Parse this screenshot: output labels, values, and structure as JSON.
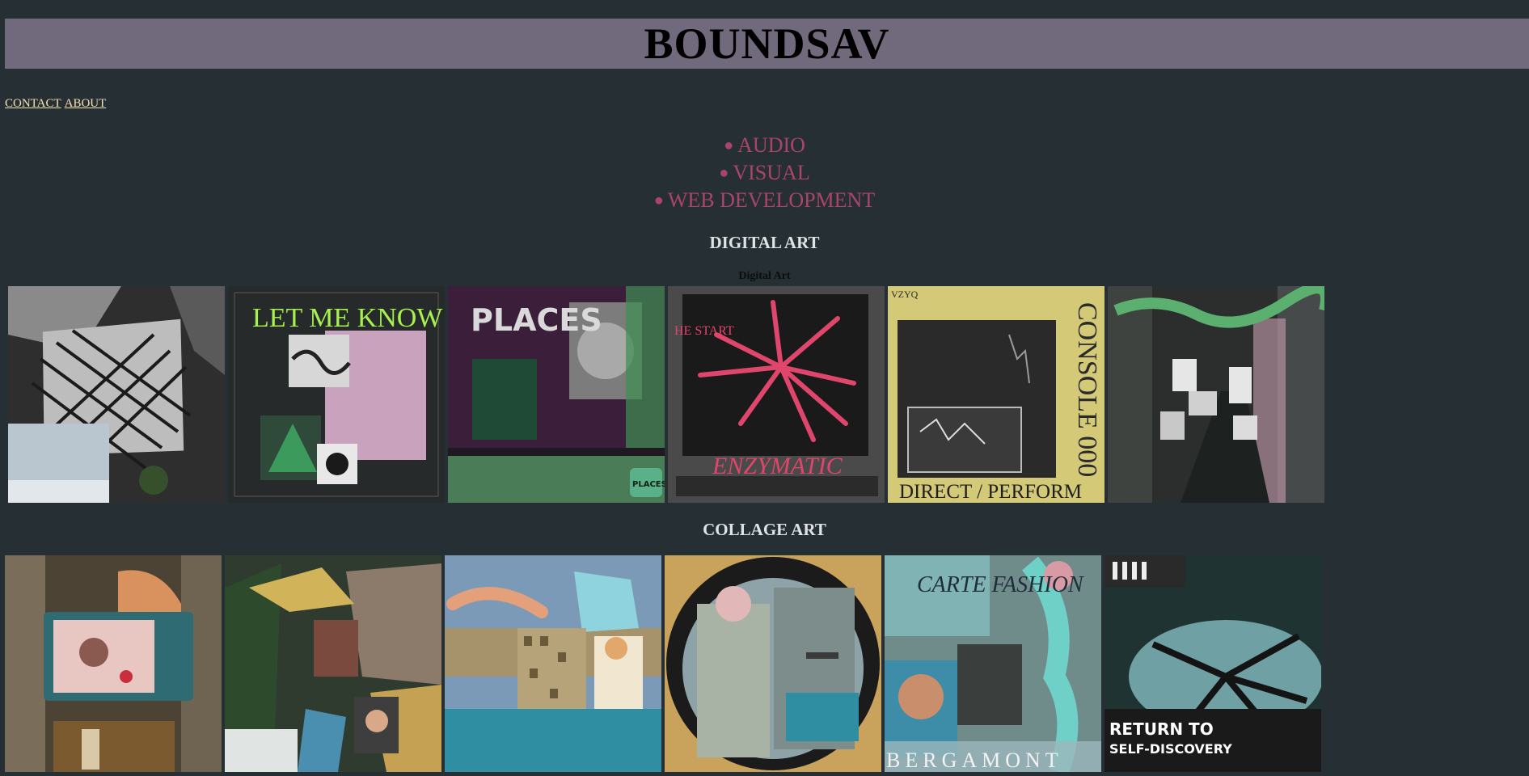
{
  "site": {
    "title": "BOUNDSAV"
  },
  "nav": [
    {
      "label": "CONTACT"
    },
    {
      "label": "ABOUT"
    }
  ],
  "services": [
    "AUDIO",
    "VISUAL",
    "WEB DEVELOPMENT"
  ],
  "digital_art": {
    "heading": "DIGITAL ART",
    "caption": "Digital Art",
    "tiles": [
      {
        "text": ""
      },
      {
        "text": "LET ME KNOW"
      },
      {
        "text": "PLACES",
        "badge": "PLACES"
      },
      {
        "text": "ENZYMATIC",
        "sub": "HE START"
      },
      {
        "text": "CONSOLE 000",
        "sub": "DIRECT / PERFORM",
        "corner": "VZYQ"
      },
      {
        "text": ""
      }
    ]
  },
  "collage_art": {
    "heading": "COLLAGE ART",
    "tiles": [
      {
        "text": ""
      },
      {
        "text": ""
      },
      {
        "text": ""
      },
      {
        "text": ""
      },
      {
        "text": "BERGAMONT",
        "sub": "CARTE FASHION"
      },
      {
        "text": "RETURN TO",
        "sub": "SELF-DISCOVERY"
      }
    ]
  },
  "colors": {
    "background": "#262f33",
    "banner": "#716a7c",
    "services": "#a9456b",
    "nav_link": "#f4e1b4"
  }
}
